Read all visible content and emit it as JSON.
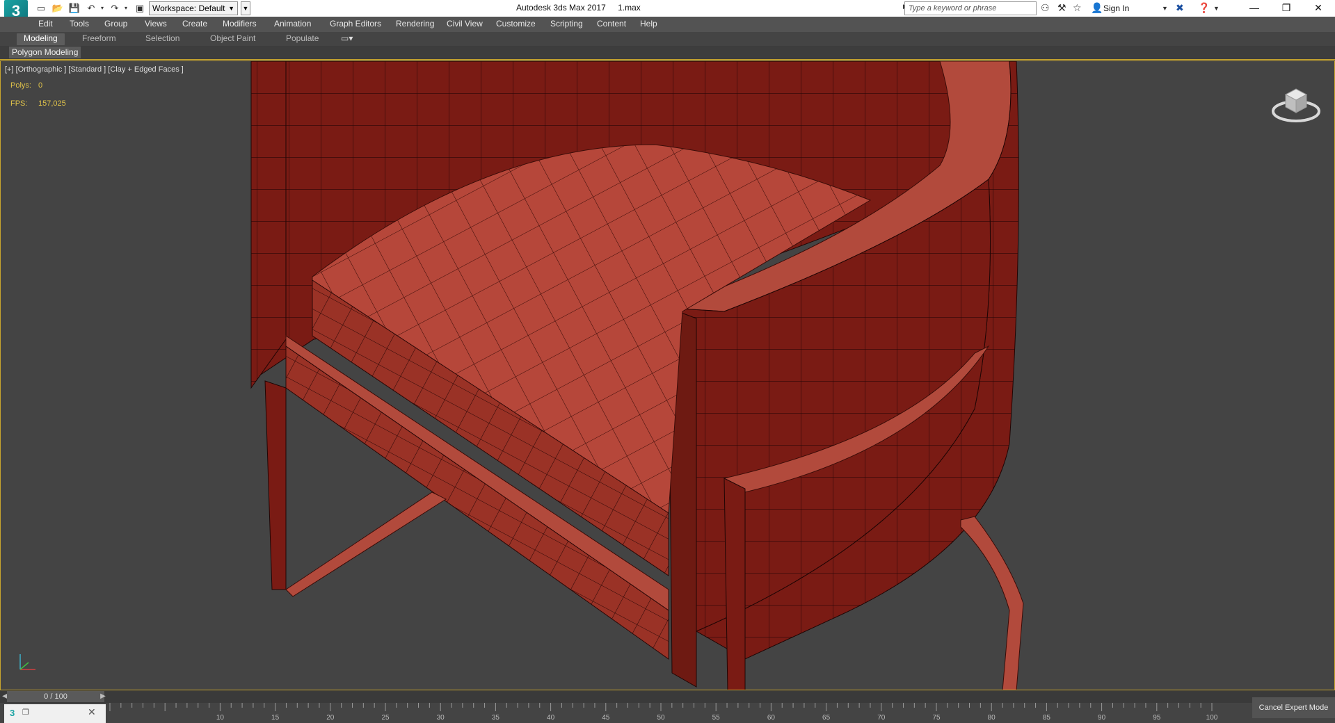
{
  "window": {
    "app_title": "Autodesk 3ds Max 2017",
    "file_name": "1.max",
    "logo_text": "3"
  },
  "quick_access": {
    "workspace_label": "Workspace: Default"
  },
  "search": {
    "placeholder": "Type a keyword or phrase"
  },
  "account": {
    "sign_in_label": "Sign In"
  },
  "menubar": {
    "items": [
      "Edit",
      "Tools",
      "Group",
      "Views",
      "Create",
      "Modifiers",
      "Animation",
      "Graph Editors",
      "Rendering",
      "Civil View",
      "Customize",
      "Scripting",
      "Content",
      "Help"
    ]
  },
  "ribbon": {
    "tabs": [
      "Modeling",
      "Freeform",
      "Selection",
      "Object Paint",
      "Populate"
    ],
    "active_tab": "Modeling",
    "panel_label": "Polygon Modeling"
  },
  "viewport": {
    "label": "[+] [Orthographic ] [Standard ] [Clay + Edged Faces ]",
    "stats": {
      "polys_label": "Polys:",
      "polys_value": "0",
      "fps_label": "FPS:",
      "fps_value": "157,025"
    },
    "model_color": "#8a2a22"
  },
  "timeline": {
    "frame_display": "0 / 100",
    "ticks": [
      10,
      15,
      20,
      25,
      30,
      35,
      40,
      45,
      50,
      55,
      60,
      65,
      70,
      75,
      80,
      85,
      90,
      95,
      100
    ]
  },
  "status": {
    "cancel_expert_label": "Cancel Expert Mode"
  },
  "colors": {
    "accent": "#c9a62d",
    "stat_text": "#e0c34a"
  }
}
